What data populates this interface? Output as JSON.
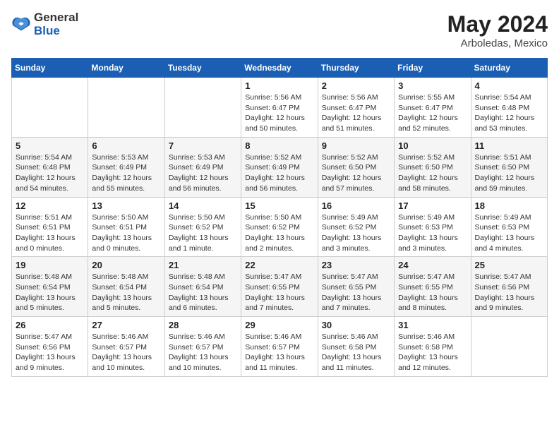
{
  "header": {
    "logo_general": "General",
    "logo_blue": "Blue",
    "title": "May 2024",
    "location": "Arboledas, Mexico"
  },
  "days_of_week": [
    "Sunday",
    "Monday",
    "Tuesday",
    "Wednesday",
    "Thursday",
    "Friday",
    "Saturday"
  ],
  "weeks": [
    [
      {
        "day": "",
        "sunrise": "",
        "sunset": "",
        "daylight": ""
      },
      {
        "day": "",
        "sunrise": "",
        "sunset": "",
        "daylight": ""
      },
      {
        "day": "",
        "sunrise": "",
        "sunset": "",
        "daylight": ""
      },
      {
        "day": "1",
        "sunrise": "Sunrise: 5:56 AM",
        "sunset": "Sunset: 6:47 PM",
        "daylight": "Daylight: 12 hours and 50 minutes."
      },
      {
        "day": "2",
        "sunrise": "Sunrise: 5:56 AM",
        "sunset": "Sunset: 6:47 PM",
        "daylight": "Daylight: 12 hours and 51 minutes."
      },
      {
        "day": "3",
        "sunrise": "Sunrise: 5:55 AM",
        "sunset": "Sunset: 6:47 PM",
        "daylight": "Daylight: 12 hours and 52 minutes."
      },
      {
        "day": "4",
        "sunrise": "Sunrise: 5:54 AM",
        "sunset": "Sunset: 6:48 PM",
        "daylight": "Daylight: 12 hours and 53 minutes."
      }
    ],
    [
      {
        "day": "5",
        "sunrise": "Sunrise: 5:54 AM",
        "sunset": "Sunset: 6:48 PM",
        "daylight": "Daylight: 12 hours and 54 minutes."
      },
      {
        "day": "6",
        "sunrise": "Sunrise: 5:53 AM",
        "sunset": "Sunset: 6:49 PM",
        "daylight": "Daylight: 12 hours and 55 minutes."
      },
      {
        "day": "7",
        "sunrise": "Sunrise: 5:53 AM",
        "sunset": "Sunset: 6:49 PM",
        "daylight": "Daylight: 12 hours and 56 minutes."
      },
      {
        "day": "8",
        "sunrise": "Sunrise: 5:52 AM",
        "sunset": "Sunset: 6:49 PM",
        "daylight": "Daylight: 12 hours and 56 minutes."
      },
      {
        "day": "9",
        "sunrise": "Sunrise: 5:52 AM",
        "sunset": "Sunset: 6:50 PM",
        "daylight": "Daylight: 12 hours and 57 minutes."
      },
      {
        "day": "10",
        "sunrise": "Sunrise: 5:52 AM",
        "sunset": "Sunset: 6:50 PM",
        "daylight": "Daylight: 12 hours and 58 minutes."
      },
      {
        "day": "11",
        "sunrise": "Sunrise: 5:51 AM",
        "sunset": "Sunset: 6:50 PM",
        "daylight": "Daylight: 12 hours and 59 minutes."
      }
    ],
    [
      {
        "day": "12",
        "sunrise": "Sunrise: 5:51 AM",
        "sunset": "Sunset: 6:51 PM",
        "daylight": "Daylight: 13 hours and 0 minutes."
      },
      {
        "day": "13",
        "sunrise": "Sunrise: 5:50 AM",
        "sunset": "Sunset: 6:51 PM",
        "daylight": "Daylight: 13 hours and 0 minutes."
      },
      {
        "day": "14",
        "sunrise": "Sunrise: 5:50 AM",
        "sunset": "Sunset: 6:52 PM",
        "daylight": "Daylight: 13 hours and 1 minute."
      },
      {
        "day": "15",
        "sunrise": "Sunrise: 5:50 AM",
        "sunset": "Sunset: 6:52 PM",
        "daylight": "Daylight: 13 hours and 2 minutes."
      },
      {
        "day": "16",
        "sunrise": "Sunrise: 5:49 AM",
        "sunset": "Sunset: 6:52 PM",
        "daylight": "Daylight: 13 hours and 3 minutes."
      },
      {
        "day": "17",
        "sunrise": "Sunrise: 5:49 AM",
        "sunset": "Sunset: 6:53 PM",
        "daylight": "Daylight: 13 hours and 3 minutes."
      },
      {
        "day": "18",
        "sunrise": "Sunrise: 5:49 AM",
        "sunset": "Sunset: 6:53 PM",
        "daylight": "Daylight: 13 hours and 4 minutes."
      }
    ],
    [
      {
        "day": "19",
        "sunrise": "Sunrise: 5:48 AM",
        "sunset": "Sunset: 6:54 PM",
        "daylight": "Daylight: 13 hours and 5 minutes."
      },
      {
        "day": "20",
        "sunrise": "Sunrise: 5:48 AM",
        "sunset": "Sunset: 6:54 PM",
        "daylight": "Daylight: 13 hours and 5 minutes."
      },
      {
        "day": "21",
        "sunrise": "Sunrise: 5:48 AM",
        "sunset": "Sunset: 6:54 PM",
        "daylight": "Daylight: 13 hours and 6 minutes."
      },
      {
        "day": "22",
        "sunrise": "Sunrise: 5:47 AM",
        "sunset": "Sunset: 6:55 PM",
        "daylight": "Daylight: 13 hours and 7 minutes."
      },
      {
        "day": "23",
        "sunrise": "Sunrise: 5:47 AM",
        "sunset": "Sunset: 6:55 PM",
        "daylight": "Daylight: 13 hours and 7 minutes."
      },
      {
        "day": "24",
        "sunrise": "Sunrise: 5:47 AM",
        "sunset": "Sunset: 6:55 PM",
        "daylight": "Daylight: 13 hours and 8 minutes."
      },
      {
        "day": "25",
        "sunrise": "Sunrise: 5:47 AM",
        "sunset": "Sunset: 6:56 PM",
        "daylight": "Daylight: 13 hours and 9 minutes."
      }
    ],
    [
      {
        "day": "26",
        "sunrise": "Sunrise: 5:47 AM",
        "sunset": "Sunset: 6:56 PM",
        "daylight": "Daylight: 13 hours and 9 minutes."
      },
      {
        "day": "27",
        "sunrise": "Sunrise: 5:46 AM",
        "sunset": "Sunset: 6:57 PM",
        "daylight": "Daylight: 13 hours and 10 minutes."
      },
      {
        "day": "28",
        "sunrise": "Sunrise: 5:46 AM",
        "sunset": "Sunset: 6:57 PM",
        "daylight": "Daylight: 13 hours and 10 minutes."
      },
      {
        "day": "29",
        "sunrise": "Sunrise: 5:46 AM",
        "sunset": "Sunset: 6:57 PM",
        "daylight": "Daylight: 13 hours and 11 minutes."
      },
      {
        "day": "30",
        "sunrise": "Sunrise: 5:46 AM",
        "sunset": "Sunset: 6:58 PM",
        "daylight": "Daylight: 13 hours and 11 minutes."
      },
      {
        "day": "31",
        "sunrise": "Sunrise: 5:46 AM",
        "sunset": "Sunset: 6:58 PM",
        "daylight": "Daylight: 13 hours and 12 minutes."
      },
      {
        "day": "",
        "sunrise": "",
        "sunset": "",
        "daylight": ""
      }
    ]
  ]
}
